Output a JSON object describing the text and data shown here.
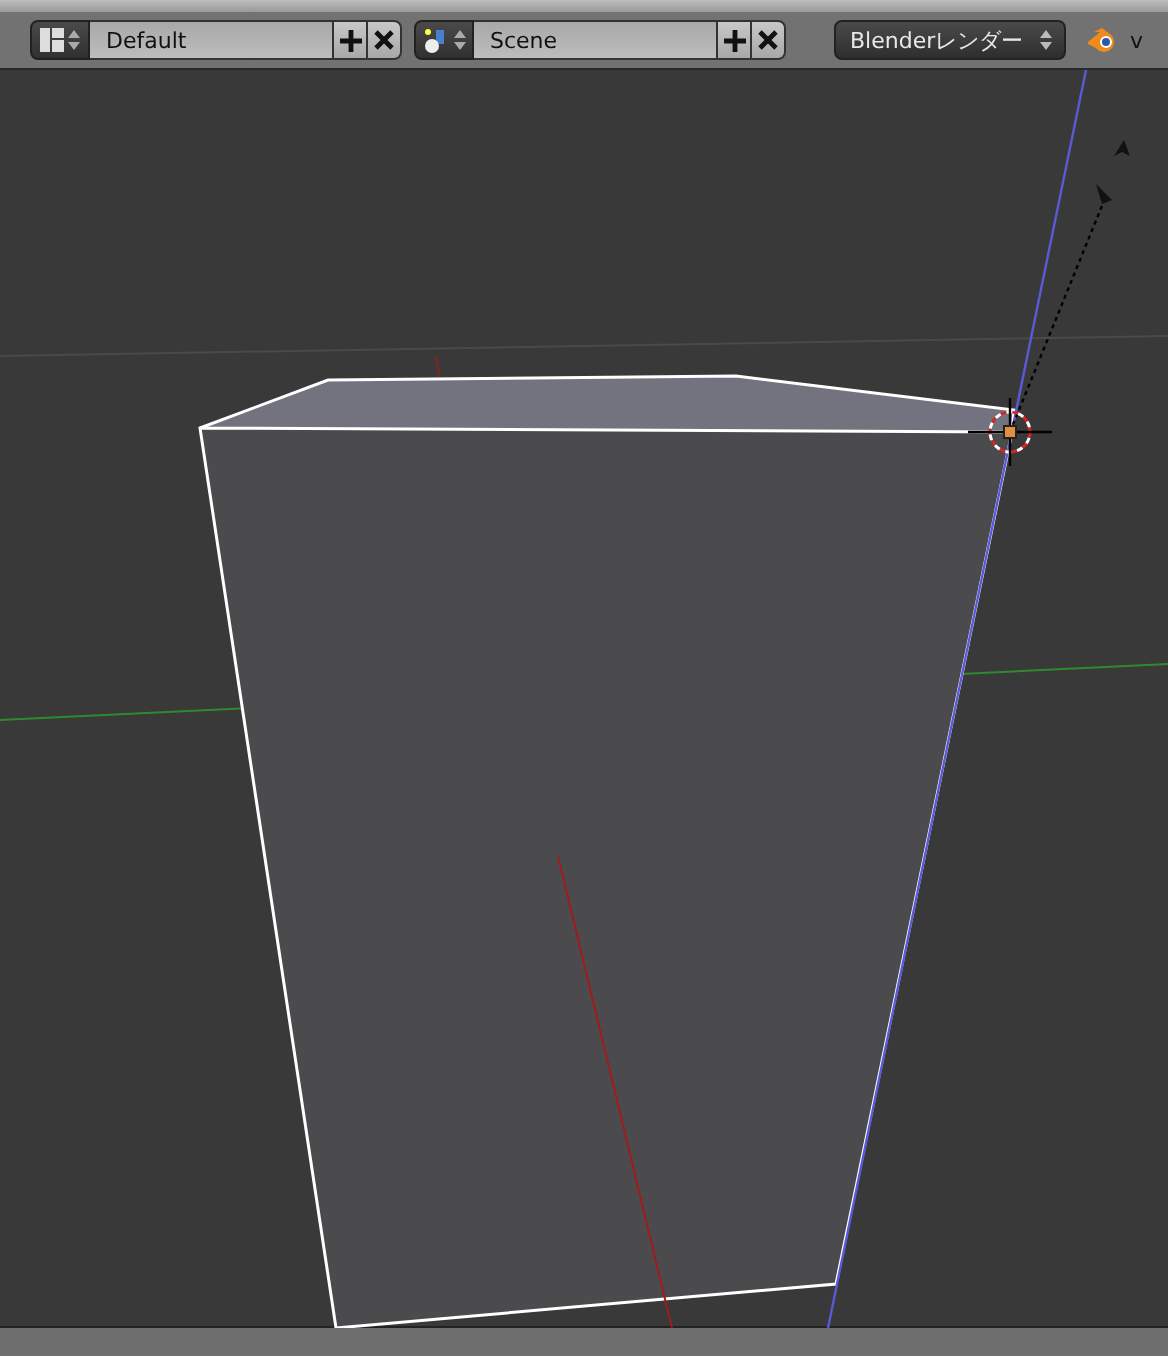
{
  "header": {
    "layout": {
      "value": "Default"
    },
    "scene": {
      "value": "Scene"
    },
    "engine": {
      "value": "Blenderレンダー"
    },
    "version": "v"
  },
  "viewport": {
    "kind": "perspective"
  }
}
